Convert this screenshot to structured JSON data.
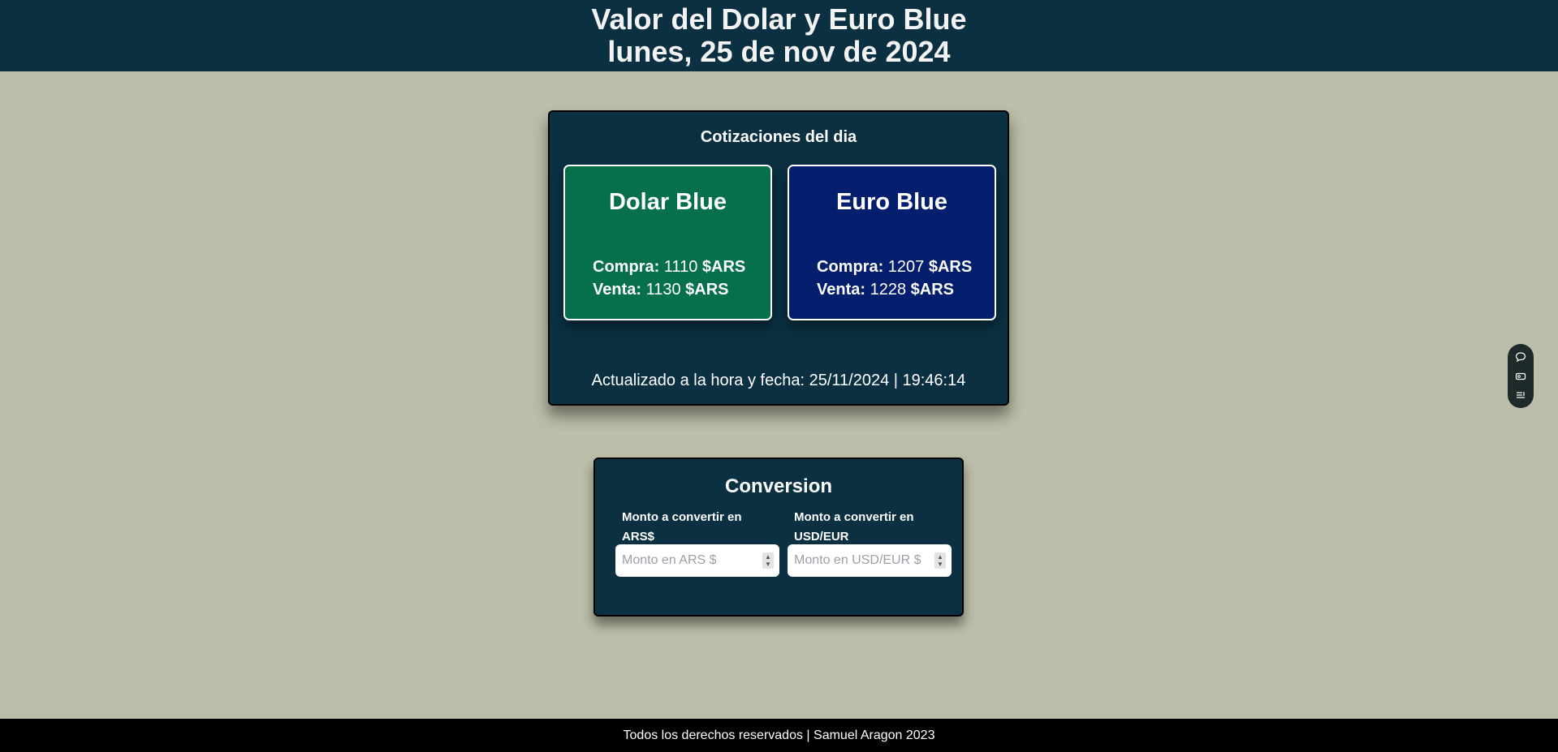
{
  "header": {
    "title": "Valor del Dolar y Euro Blue",
    "date": "lunes, 25 de nov de 2024"
  },
  "rates": {
    "title": "Cotizaciones del dia",
    "usd": {
      "name": "Dolar Blue",
      "buy_label": "Compra:",
      "buy_value": "1110",
      "sell_label": "Venta:",
      "sell_value": "1130",
      "currency": "$ARS"
    },
    "eur": {
      "name": "Euro Blue",
      "buy_label": "Compra:",
      "buy_value": "1207",
      "sell_label": "Venta:",
      "sell_value": "1228",
      "currency": "$ARS"
    },
    "updated": "Actualizado a la hora y fecha: 25/11/2024 | 19:46:14"
  },
  "conversion": {
    "title": "Conversion",
    "ars_label": "Monto a convertir en ARS$",
    "ars_placeholder": "Monto en ARS $",
    "usd_label": "Monto a convertir en USD/EUR",
    "usd_placeholder": "Monto en USD/EUR $"
  },
  "side_widget": {
    "icons": [
      "chat-icon",
      "card-icon",
      "list-settings-icon"
    ]
  },
  "footer": {
    "text": "Todos los derechos reservados | Samuel Aragon 2023"
  },
  "colors": {
    "background": "#bbbea8",
    "header": "#0b3042",
    "usd_box": "#06704b",
    "eur_box": "#041e6e",
    "footer": "#000000"
  }
}
